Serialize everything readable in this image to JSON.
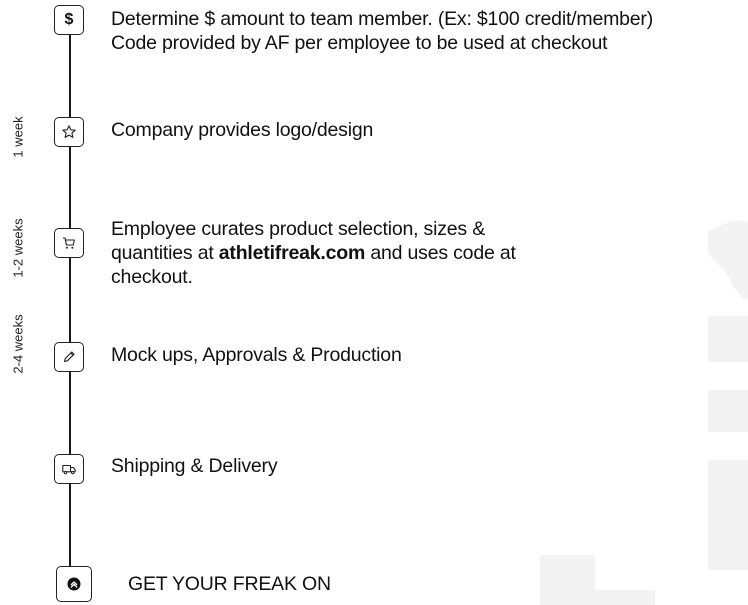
{
  "steps": [
    {
      "icon": "dollar-icon",
      "glyph": "$",
      "lines": [
        "Determine $ amount to team member. (Ex: $100 credit/member)",
        "Code provided by AF per employee to be used at checkout"
      ]
    },
    {
      "icon": "star-icon",
      "lines": [
        "Company provides logo/design"
      ]
    },
    {
      "icon": "cart-icon",
      "line1": "Employee curates product selection, sizes &",
      "line2_pre": "quantities at ",
      "line2_bold": "athletifreak.com",
      "line2_post": " and uses code at",
      "line3": "checkout."
    },
    {
      "icon": "pencil-icon",
      "lines": [
        "Mock ups, Approvals & Production"
      ]
    },
    {
      "icon": "truck-icon",
      "lines": [
        "Shipping & Delivery"
      ]
    }
  ],
  "durations": [
    "1 week",
    "1-2 weeks",
    "2-4 weeks"
  ],
  "cta": {
    "label": "GET YOUR FREAK ON",
    "icon": "chevrons-up-icon"
  },
  "colors": {
    "text": "#111111",
    "line": "#1a1a1a",
    "watermark": "#f3f3f3",
    "background": "#ffffff"
  }
}
